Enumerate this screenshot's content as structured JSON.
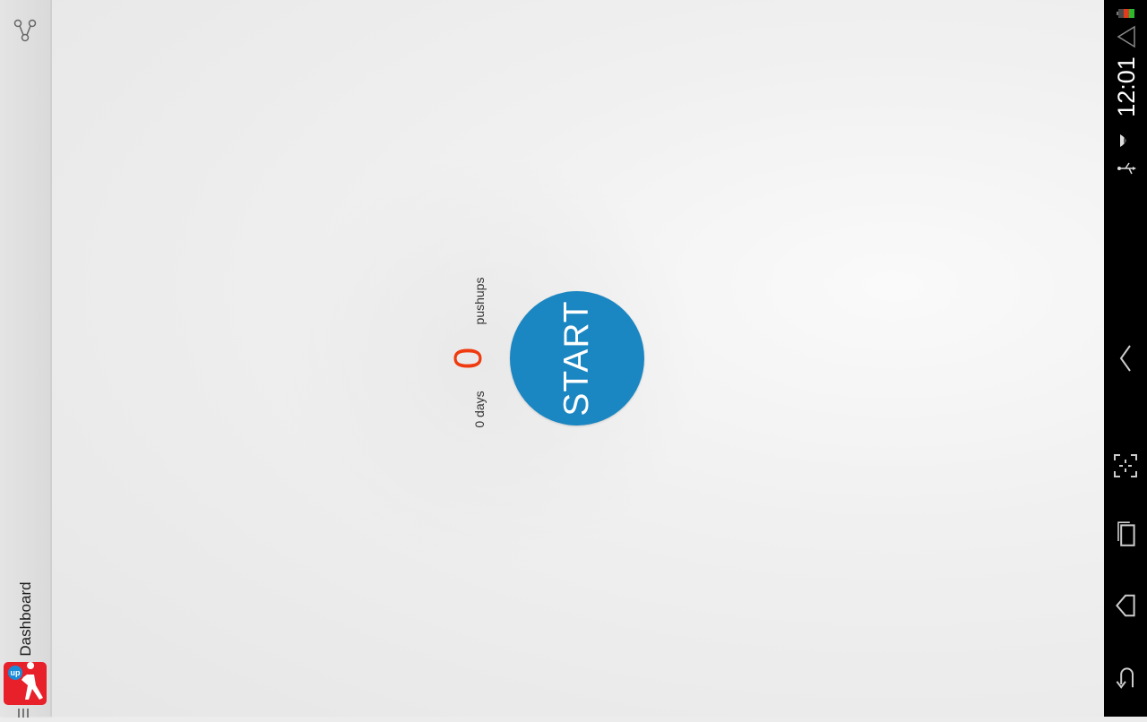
{
  "action_bar": {
    "title": "Dashboard",
    "app_icon_badge": "up",
    "share_icon": "share-icon"
  },
  "main": {
    "pushups_label": "pushups",
    "count": "0",
    "days_label": "0 days",
    "start_label": "START",
    "accent_color": "#1a86c2",
    "count_color": "#ef3b0f"
  },
  "status_bar": {
    "time": "12:01",
    "icons": [
      "battery-icon",
      "signal-icon",
      "wifi-icon",
      "usb-icon"
    ]
  },
  "nav_bar": {
    "buttons": [
      "collapse-icon",
      "screenshot-icon",
      "recent-apps-icon",
      "home-icon",
      "back-icon"
    ]
  }
}
